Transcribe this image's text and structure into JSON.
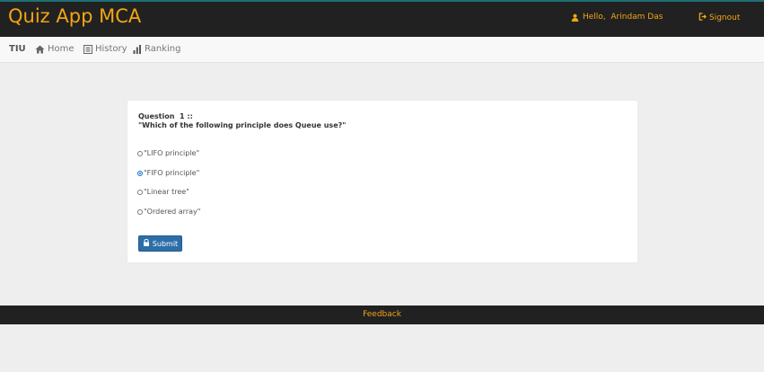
{
  "header": {
    "brand": "Quiz App MCA",
    "greeting": "Hello,  Arindam Das",
    "signout_label": "Signout",
    "accent_color": "#f2a516"
  },
  "nav": {
    "brand": "TIU",
    "items": [
      {
        "label": "Home",
        "icon": "home-icon"
      },
      {
        "label": "History",
        "icon": "history-icon"
      },
      {
        "label": "Ranking",
        "icon": "bar-chart-icon"
      }
    ]
  },
  "question": {
    "label": "Question  1 ::",
    "text": "\"Which of the following principle does Queue use?\"",
    "options": [
      {
        "label": "\"LIFO principle\"",
        "selected": false
      },
      {
        "label": "\"FIFO principle\"",
        "selected": true
      },
      {
        "label": "\"Linear tree\"",
        "selected": false
      },
      {
        "label": "\"Ordered array\"",
        "selected": false
      }
    ],
    "submit_label": "Submit"
  },
  "footer": {
    "feedback_label": "Feedback"
  }
}
